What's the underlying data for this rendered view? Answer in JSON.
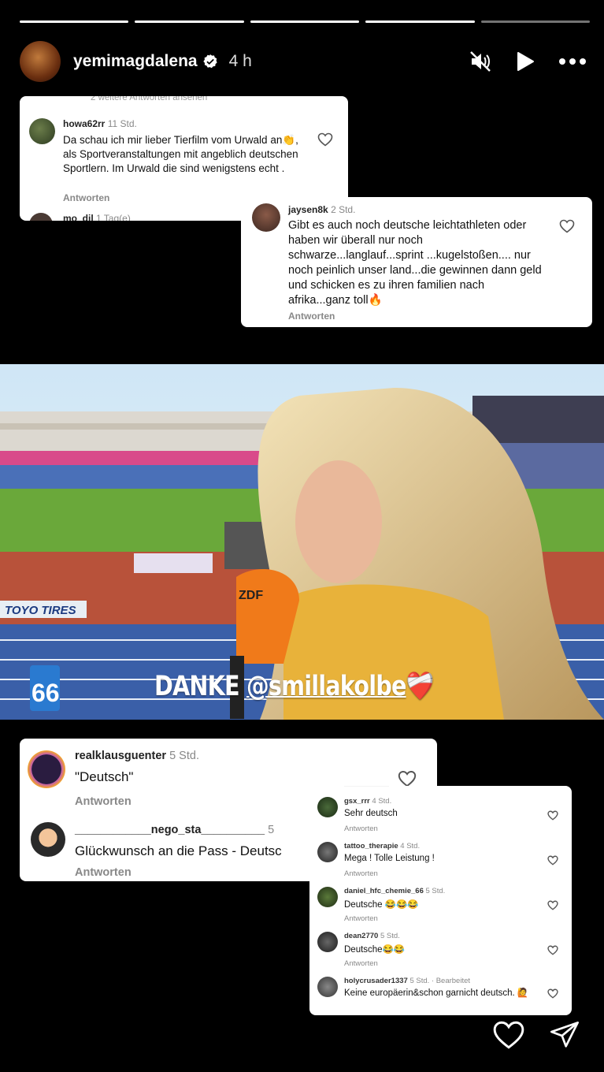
{
  "story": {
    "username": "yemimagdalena",
    "time": "4 h",
    "segments": 5,
    "segments_done": 4
  },
  "card1": {
    "top_fragment": "2 weitere Antworten ansehen",
    "user": "howa62rr",
    "ago": "11 Std.",
    "text": "Da schau ich mir lieber Tierfilm vom Urwald an👏, als Sportveranstaltungen mit angeblich deutschen Sportlern. Im Urwald die sind wenigstens echt .",
    "reply": "Antworten",
    "next_user": "mo_dil",
    "next_ago": "1 Tag(e)"
  },
  "card2": {
    "user": "jaysen8k",
    "ago": "2 Std.",
    "text": "Gibt es auch noch deutsche leichtathleten oder haben wir überall nur noch schwarze...langlauf...sprint ...kugelstoßen.... nur noch peinlich unser land...die gewinnen dann geld und schicken es zu ihren familien nach afrika...ganz toll🔥",
    "reply": "Antworten"
  },
  "photo": {
    "caption_prefix": "DANKE ",
    "caption_handle": "@smillakolbe",
    "caption_emoji": "❤️‍🩹",
    "banner": "TOYO TIRES",
    "lane_number": "66",
    "mic_logo": "ZDF"
  },
  "card3": {
    "user1": "realklausguenter",
    "ago1": "5 Std.",
    "text1": "\"Deutsch\"",
    "reply1": "Antworten",
    "user2": "____________nego_sta__________",
    "ago2": "5",
    "text2": "Glückwunsch an die Pass - Deutsc",
    "reply2": "Antworten"
  },
  "card4": {
    "rows": [
      {
        "user": "gsx_rrr",
        "ago": "4 Std.",
        "text": "Sehr deutsch",
        "reply": "Antworten"
      },
      {
        "user": "tattoo_therapie",
        "ago": "4 Std.",
        "text": "Mega ! Tolle Leistung !",
        "reply": "Antworten"
      },
      {
        "user": "daniel_hfc_chemie_66",
        "ago": "5 Std.",
        "text": "Deutsche 😂😂😂",
        "reply": "Antworten"
      },
      {
        "user": "dean2770",
        "ago": "5 Std.",
        "text": "Deutsche😂😂",
        "reply": "Antworten"
      },
      {
        "user": "holycrusader1337",
        "ago": "5 Std. · Bearbeitet",
        "text": "Keine europäerin&schon garnicht deutsch. 🙋",
        "reply": ""
      }
    ]
  },
  "colors": {
    "background": "#000000",
    "card": "#ffffff",
    "track": "#b8523a",
    "grass": "#6aa83a",
    "jersey": "#e8b23a",
    "mic": "#f07a1a"
  }
}
